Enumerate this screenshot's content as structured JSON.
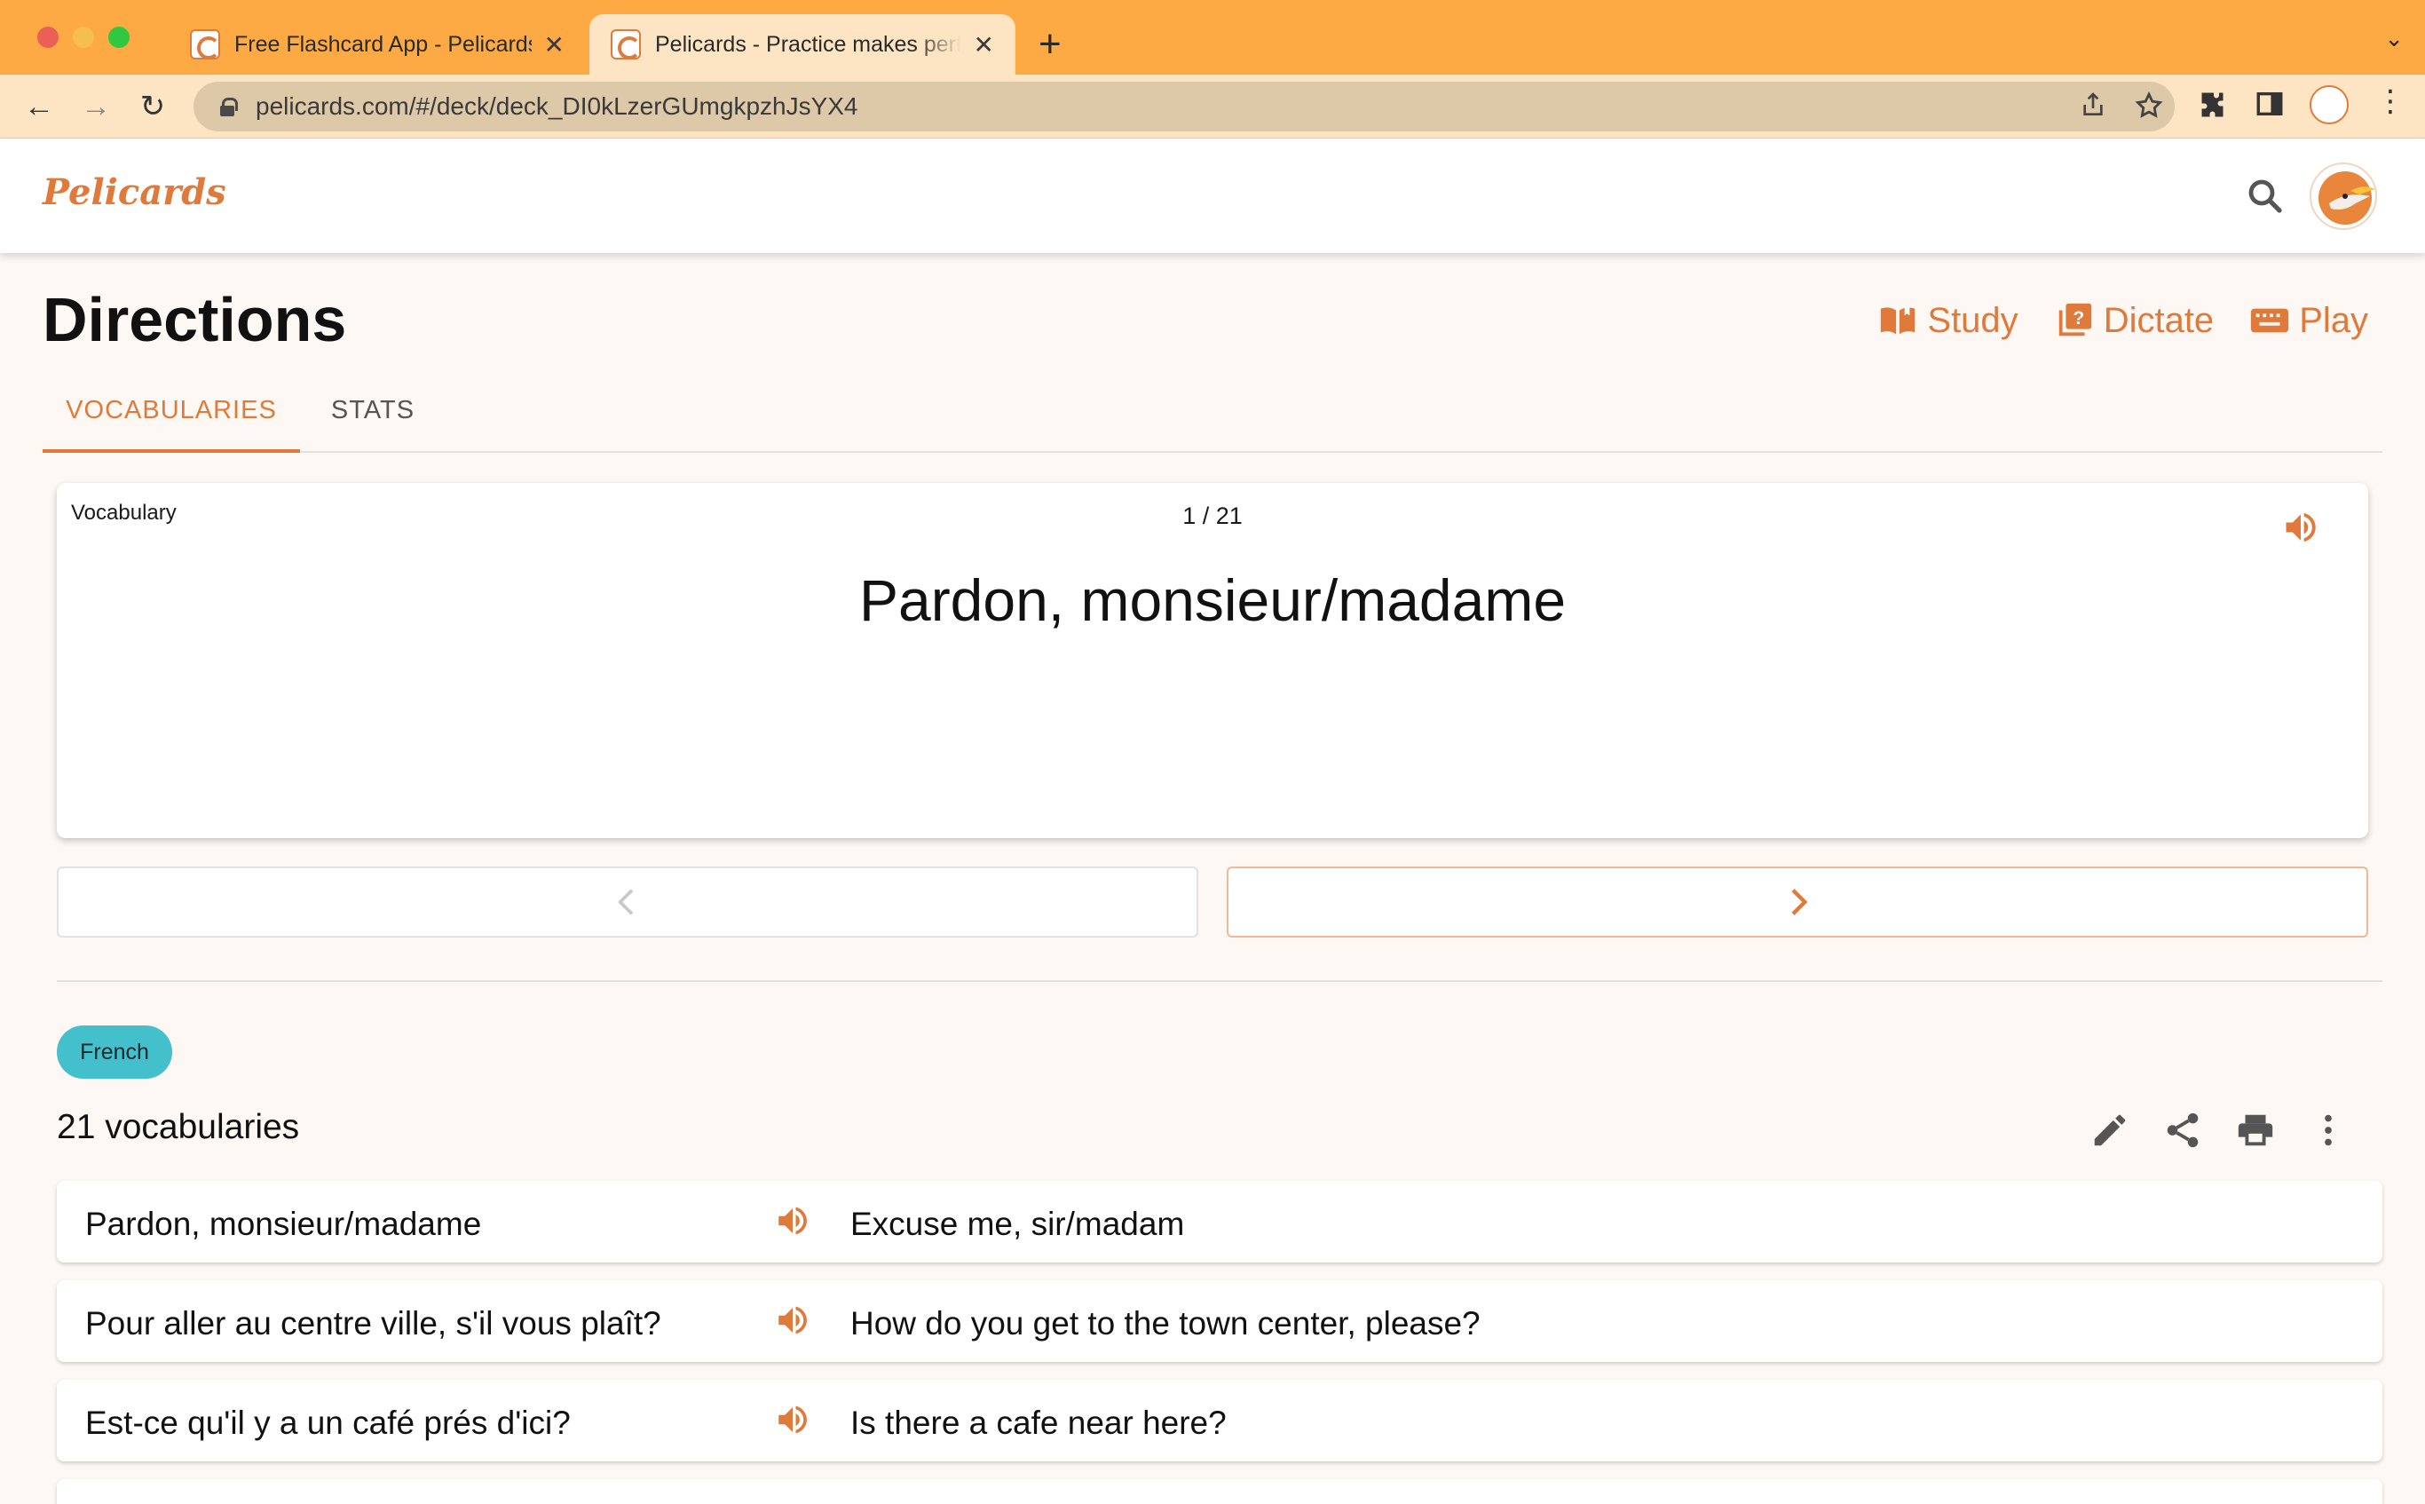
{
  "browser": {
    "tabs": [
      {
        "title": "Free Flashcard App - Pelicards"
      },
      {
        "title": "Pelicards - Practice makes perfect"
      }
    ],
    "url": "pelicards.com/#/deck/deck_DI0kLzerGUmgkpzhJsYX4"
  },
  "app": {
    "logo": "Pelicards",
    "brand_color": "#e07a3a"
  },
  "deck": {
    "title": "Directions",
    "actions": [
      {
        "label": "Study",
        "icon": "book-open-icon"
      },
      {
        "label": "Dictate",
        "icon": "quiz-icon"
      },
      {
        "label": "Play",
        "icon": "keyboard-icon"
      }
    ],
    "tabs": [
      {
        "label": "VOCABULARIES",
        "active": true
      },
      {
        "label": "STATS",
        "active": false
      }
    ]
  },
  "card": {
    "label": "Vocabulary",
    "counter": "1 / 21",
    "term": "Pardon, monsieur/madame"
  },
  "language_chip": {
    "label": "French",
    "color": "#43c0cc"
  },
  "list": {
    "count_label": "21 vocabularies",
    "items": [
      {
        "term": "Pardon, monsieur/madame",
        "definition": "Excuse me, sir/madam"
      },
      {
        "term": "Pour aller au centre ville, s'il vous plaît?",
        "definition": "How do you get to the town center, please?"
      },
      {
        "term": "Est-ce qu'il y a un café prés d'ici?",
        "definition": "Is there a cafe near here?"
      }
    ]
  }
}
